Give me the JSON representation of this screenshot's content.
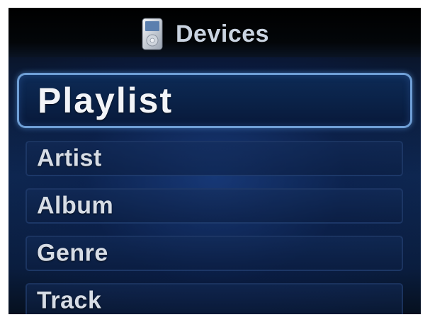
{
  "header": {
    "title": "Devices",
    "icon": "ipod-device-icon"
  },
  "menu": {
    "items": [
      {
        "label": "Playlist",
        "selected": true
      },
      {
        "label": "Artist",
        "selected": false
      },
      {
        "label": "Album",
        "selected": false
      },
      {
        "label": "Genre",
        "selected": false
      },
      {
        "label": "Track",
        "selected": false
      }
    ]
  },
  "colors": {
    "highlight_border": "#6f9fd6",
    "background": "#0e2750",
    "text": "#d7dde6"
  }
}
